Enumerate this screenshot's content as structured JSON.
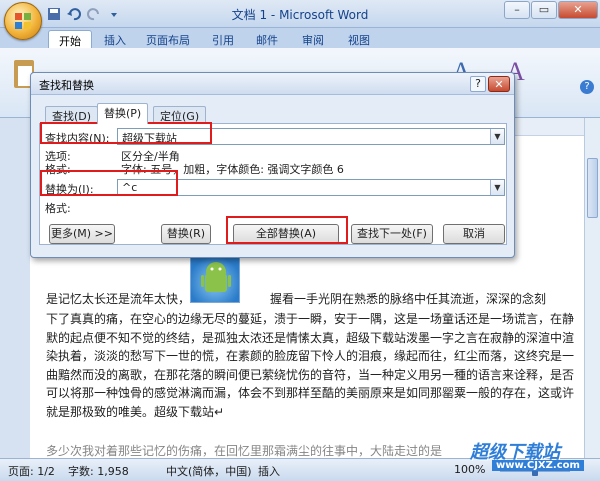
{
  "window": {
    "title": "文档 1 - Microsoft Word",
    "controls": [
      "–",
      "▭",
      "✕"
    ]
  },
  "ribbon": {
    "tabs": [
      "开始",
      "插入",
      "页面布局",
      "引用",
      "邮件",
      "审阅",
      "视图"
    ]
  },
  "dialog": {
    "title": "查找和替换",
    "help": "?",
    "close": "✕",
    "tabs": [
      "查找(D)",
      "替换(P)",
      "定位(G)"
    ],
    "find_label": "查找内容(N):",
    "find_value": "超级下载站",
    "options_label": "选项:",
    "options_value": "区分全/半角",
    "format_label": "格式:",
    "format_value": "字体: 五号，加粗，字体颜色: 强调文字颜色 6",
    "replace_label": "替换为(I):",
    "replace_value": "^c",
    "replace_format_label": "格式:",
    "buttons": {
      "more": "更多(M) >>",
      "replace": "替换(R)",
      "replace_all": "全部替换(A)",
      "find_next": "查找下一处(F)",
      "cancel": "取消"
    }
  },
  "document": {
    "line1a": "是记忆太长还是流年太快，",
    "line1b": "握看一手光阴在熟悉的脉络中任其流逝，深深的念刻",
    "body": "下了真真的痛，在空心的边缘无尽的蔓延，溃于一瞬，安于一隅，这是一场童话还是一场谎言，在静默的起点便不知不觉的终结，是孤独太浓还是情愫太真，超级下载站泼墨一字之言在寂静的深渲中渲染执着，淡淡的愁写下一世的慌，在素颜的脸庞留下怜人的泪痕，缘起而往，红尘而落，这终究是一曲黯然而没的离歌，在那花落的瞬间便已萦绕忧伤的音符，当一种定义用另一種的语言来诠释，是否可以将那一种蚀骨的感觉淋漓而漏，体会不到那样至酷的美丽原来是如同那罂粟一般的存在，这或许就是那极致的唯美。超级下载站↵",
    "tail": "多少次我对着那些记忆的伤痛，在回忆里那霜满尘的往事中，大陆走过的是那种缘分"
  },
  "status": {
    "page": "页面: 1/2",
    "words": "字数: 1,958",
    "language": "中文(简体，中国)",
    "mode": "插入",
    "zoom": "100%",
    "zoom_fraction": 0.5
  },
  "watermark": {
    "name": "超级下载站",
    "url": "www.CJXZ.com"
  },
  "colors": {
    "highlight": "#e01b1b",
    "ribbon_text": "#15428b"
  }
}
